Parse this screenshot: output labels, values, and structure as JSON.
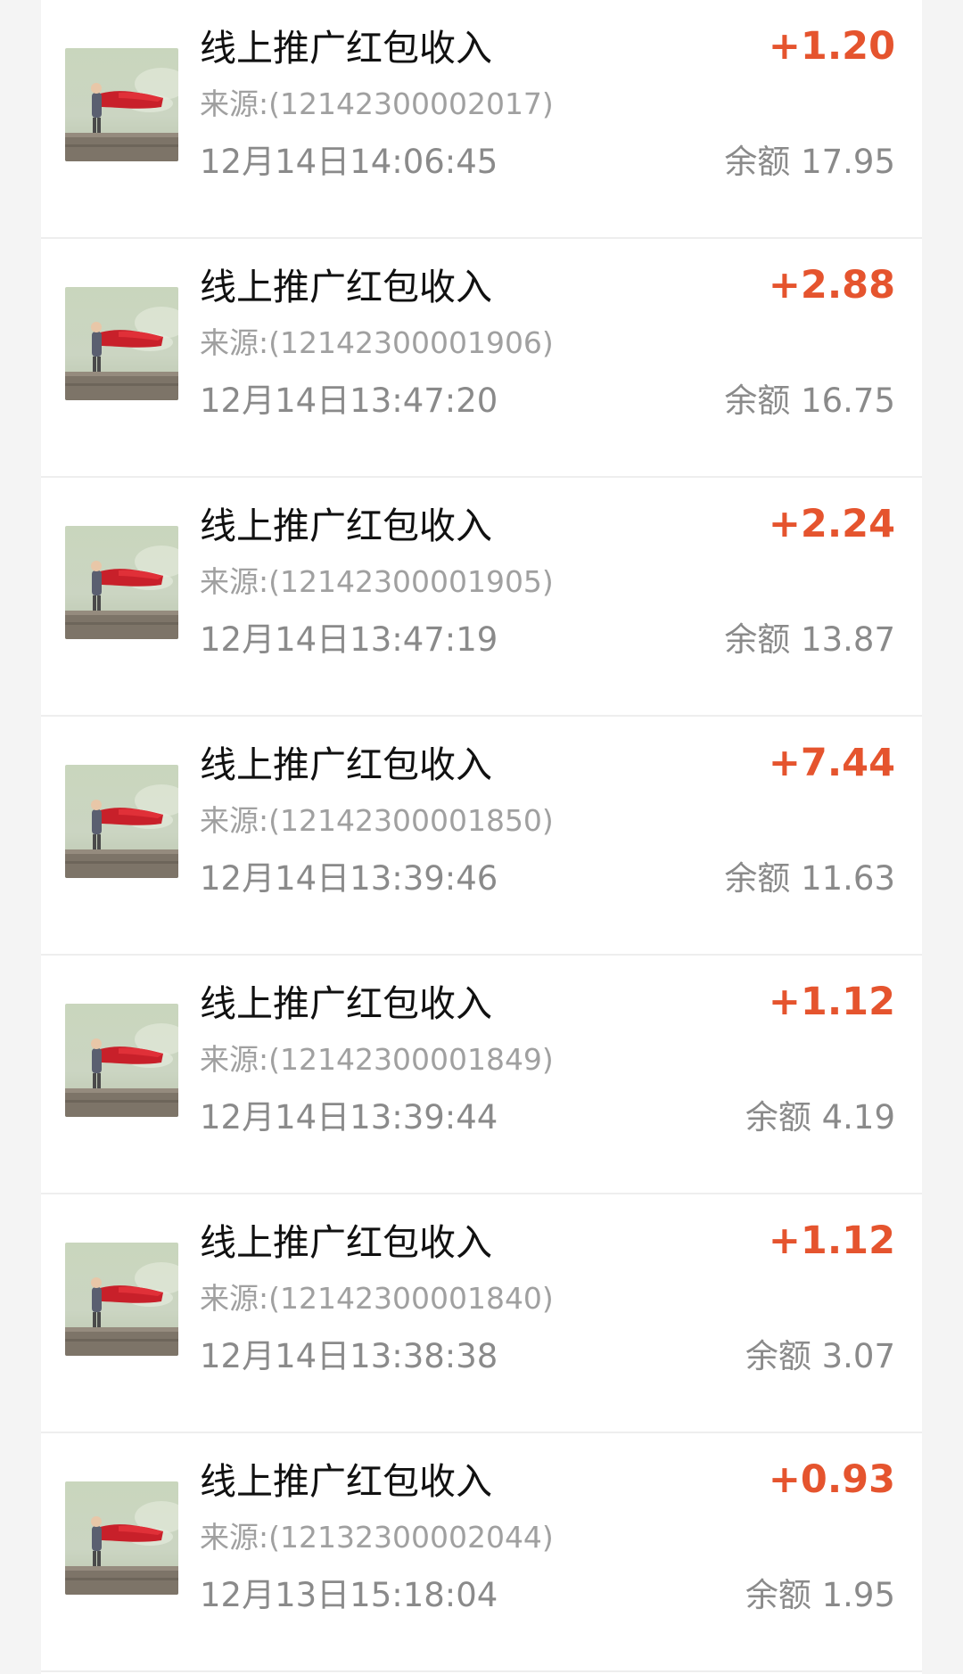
{
  "transactions": [
    {
      "title": "线上推广红包收入",
      "amount": "+1.20",
      "source": "来源:(12142300002017)",
      "time": "12月14日14:06:45",
      "balance": "余额 17.95"
    },
    {
      "title": "线上推广红包收入",
      "amount": "+2.88",
      "source": "来源:(12142300001906)",
      "time": "12月14日13:47:20",
      "balance": "余额 16.75"
    },
    {
      "title": "线上推广红包收入",
      "amount": "+2.24",
      "source": "来源:(12142300001905)",
      "time": "12月14日13:47:19",
      "balance": "余额 13.87"
    },
    {
      "title": "线上推广红包收入",
      "amount": "+7.44",
      "source": "来源:(12142300001850)",
      "time": "12月14日13:39:46",
      "balance": "余额 11.63"
    },
    {
      "title": "线上推广红包收入",
      "amount": "+1.12",
      "source": "来源:(12142300001849)",
      "time": "12月14日13:39:44",
      "balance": "余额 4.19"
    },
    {
      "title": "线上推广红包收入",
      "amount": "+1.12",
      "source": "来源:(12142300001840)",
      "time": "12月14日13:38:38",
      "balance": "余额 3.07"
    },
    {
      "title": "线上推广红包收入",
      "amount": "+0.93",
      "source": "来源:(12132300002044)",
      "time": "12月13日15:18:04",
      "balance": "余额 1.95"
    }
  ],
  "colors": {
    "amount": "#e5542e",
    "title": "#111111",
    "secondary": "#8a8a8a",
    "background": "#f4f4f4",
    "card": "#ffffff"
  },
  "icons": {
    "avatar": "child-with-red-cape-avatar-icon"
  }
}
